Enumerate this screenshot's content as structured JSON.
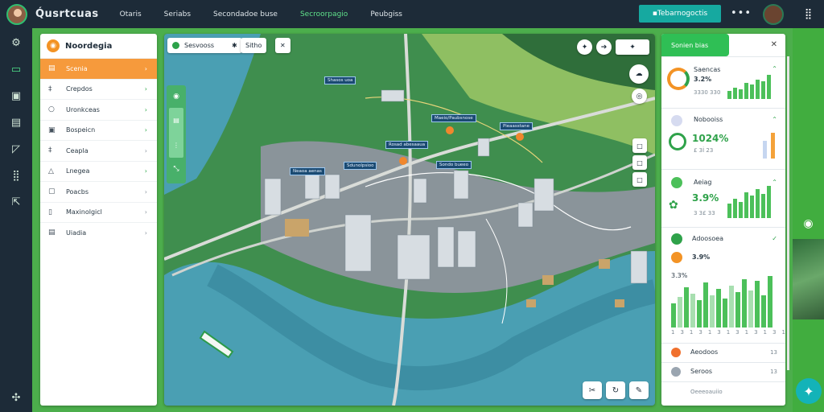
{
  "topbar": {
    "brand": "Q́usrtcuas",
    "nav": [
      "Otaris",
      "Seriabs",
      "Secondadoe buse",
      "Secroorpagio",
      "Peubgiss"
    ],
    "cta_label": "Tebarnogoctis",
    "more": "•••"
  },
  "leftbar": {
    "icons": [
      "globe-icon",
      "layers-icon",
      "inbox-icon",
      "chart-icon",
      "flag-icon",
      "grid-icon",
      "share-icon"
    ],
    "bottom_icon": "compass-icon"
  },
  "panel": {
    "title": "Noordegia",
    "items": [
      {
        "label": "Scenia",
        "icon": "▤",
        "chev": "›",
        "active": true
      },
      {
        "label": "Crepdos",
        "icon": "‡",
        "chev": "›",
        "tone": "g"
      },
      {
        "label": "Uronkceas",
        "icon": "○",
        "chev": "›",
        "tone": "g"
      },
      {
        "label": "Bospeicn",
        "icon": "▣",
        "chev": "›",
        "tone": "g"
      },
      {
        "label": "Ceapla",
        "icon": "‡",
        "chev": "›",
        "tone": "d"
      },
      {
        "label": "Lnegea",
        "icon": "△",
        "chev": "›",
        "tone": "g"
      },
      {
        "label": "Poacbs",
        "icon": "▢",
        "chev": "›",
        "tone": "d"
      },
      {
        "label": "Maxinolgicl",
        "icon": "▯",
        "chev": "›",
        "tone": "d"
      },
      {
        "label": "Uiadia",
        "icon": "▤",
        "chev": "›",
        "tone": "d"
      }
    ]
  },
  "map": {
    "toolbar": [
      "Sesvooss",
      "Sitho",
      "✕"
    ],
    "toolbar_icon": "✱",
    "tags": [
      "Shasos uoa",
      "Maeio/Paubsnose",
      "Pieaasstane",
      "Rosad abesaaua",
      "Sdunolpsioo",
      "Neaoa aenas",
      "Sondo bueeo"
    ],
    "right_controls": [
      "✦",
      "➔",
      "✦"
    ],
    "bottom_controls": [
      "✂",
      "↻",
      "✎"
    ],
    "zoom_icons": [
      "□",
      "□",
      "□"
    ]
  },
  "sidepanel": {
    "title": "Sonien bias",
    "cards": [
      {
        "label": "Saencas",
        "value": "3.2%",
        "sub": "3330 330"
      },
      {
        "label": "Nobooiss",
        "value": "1024%",
        "sub": "£ 3İ 23"
      },
      {
        "label": "Aeiag",
        "value": "3.9%",
        "sub": "3 3£ 33"
      },
      {
        "label": "Adoosoea",
        "value": "3.9%",
        "sub": "3.3%"
      },
      {
        "label": "Aeodoos",
        "value": "",
        "sub": "13"
      },
      {
        "label": "Seroos",
        "value": "",
        "sub": "13"
      }
    ],
    "chart_note": "13",
    "footer": "Oeeeoauiio"
  },
  "colors": {
    "accent_green": "#2fbf55",
    "accent_orange": "#f69a3c",
    "nav_dark": "#1d2b38",
    "teal": "#16a9a0"
  }
}
